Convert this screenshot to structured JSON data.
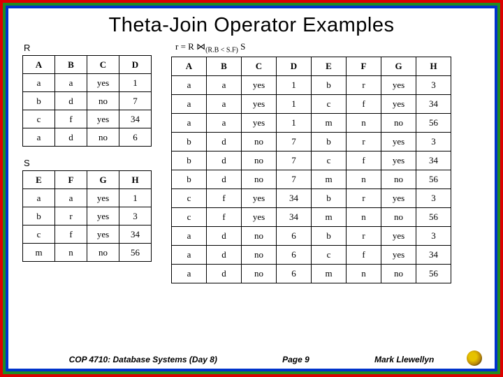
{
  "title": "Theta-Join Operator Examples",
  "labels": {
    "R": "R",
    "S": "S"
  },
  "join_expr": {
    "prefix": "r = R ⋈",
    "sub": "(R.B < S.F)",
    "suffix": " S"
  },
  "tableR": {
    "headers": [
      "A",
      "B",
      "C",
      "D"
    ],
    "rows": [
      [
        "a",
        "a",
        "yes",
        "1"
      ],
      [
        "b",
        "d",
        "no",
        "7"
      ],
      [
        "c",
        "f",
        "yes",
        "34"
      ],
      [
        "a",
        "d",
        "no",
        "6"
      ]
    ]
  },
  "tableS": {
    "headers": [
      "E",
      "F",
      "G",
      "H"
    ],
    "rows": [
      [
        "a",
        "a",
        "yes",
        "1"
      ],
      [
        "b",
        "r",
        "yes",
        "3"
      ],
      [
        "c",
        "f",
        "yes",
        "34"
      ],
      [
        "m",
        "n",
        "no",
        "56"
      ]
    ]
  },
  "tableResult": {
    "headers": [
      "A",
      "B",
      "C",
      "D",
      "E",
      "F",
      "G",
      "H"
    ],
    "rows": [
      [
        "a",
        "a",
        "yes",
        "1",
        "b",
        "r",
        "yes",
        "3"
      ],
      [
        "a",
        "a",
        "yes",
        "1",
        "c",
        "f",
        "yes",
        "34"
      ],
      [
        "a",
        "a",
        "yes",
        "1",
        "m",
        "n",
        "no",
        "56"
      ],
      [
        "b",
        "d",
        "no",
        "7",
        "b",
        "r",
        "yes",
        "3"
      ],
      [
        "b",
        "d",
        "no",
        "7",
        "c",
        "f",
        "yes",
        "34"
      ],
      [
        "b",
        "d",
        "no",
        "7",
        "m",
        "n",
        "no",
        "56"
      ],
      [
        "c",
        "f",
        "yes",
        "34",
        "b",
        "r",
        "yes",
        "3"
      ],
      [
        "c",
        "f",
        "yes",
        "34",
        "m",
        "n",
        "no",
        "56"
      ],
      [
        "a",
        "d",
        "no",
        "6",
        "b",
        "r",
        "yes",
        "3"
      ],
      [
        "a",
        "d",
        "no",
        "6",
        "c",
        "f",
        "yes",
        "34"
      ],
      [
        "a",
        "d",
        "no",
        "6",
        "m",
        "n",
        "no",
        "56"
      ]
    ]
  },
  "footer": {
    "left": "COP 4710: Database Systems  (Day 8)",
    "center": "Page 9",
    "right": "Mark Llewellyn"
  }
}
